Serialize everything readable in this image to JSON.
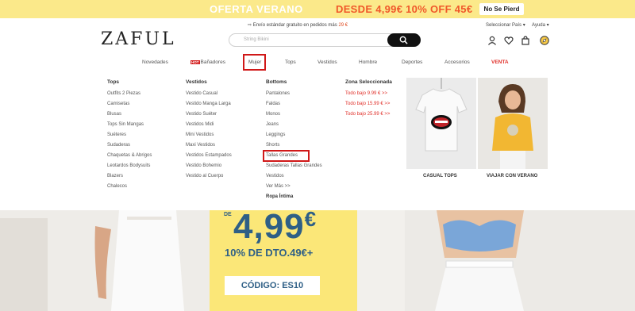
{
  "promo": {
    "left_text": "OFERTA VERANO",
    "right_text": "DESDE 4,99€ 10% OFF 45€",
    "button": "No Se Pierd"
  },
  "info": {
    "shipping_prefix": "Envío estándar gratuito en pedidos más",
    "shipping_amount": "29 €",
    "country": "Seleccionar País ▾",
    "help": "Ayuda ▾"
  },
  "header": {
    "logo": "ZAFUL",
    "search_placeholder": "String Bikini"
  },
  "nav": {
    "items": [
      "Novedades",
      "Bañadores",
      "Mujer",
      "Tops",
      "Vestidos",
      "Hombre",
      "Deportes",
      "Accesorios",
      "VENTA"
    ],
    "hot_badge": "HOT"
  },
  "menu": {
    "tops": {
      "title": "Tops",
      "items": [
        "Outfits 2 Piezas",
        "Camisetas",
        "Blusas",
        "Tops Sin Mangas",
        "Suéteres",
        "Sudaderas",
        "Chaquetas & Abrigos",
        "Leotardos Bodysuits",
        "Blazers",
        "Chalecos"
      ]
    },
    "vestidos": {
      "title": "Vestidos",
      "items": [
        "Vestido Casual",
        "Vestido Manga Larga",
        "Vestido Suéter",
        "Vestidos Midi",
        "Mini Vestidos",
        "Maxi Vestidos",
        "Vestidos Estampados",
        "Vestido Bohemio",
        "Vestido al Cuerpo"
      ]
    },
    "bottoms": {
      "title": "Bottoms",
      "items": [
        "Pantalones",
        "Faldas",
        "Monos",
        "Jeans",
        "Leggings",
        "Shorts",
        "Tallas Grandes",
        "Sudaderas Tallas Grandes",
        "Vestidos",
        "Ver Más >>"
      ],
      "extra": "Ropa Íntima"
    },
    "zona": {
      "title": "Zona Seleccionada",
      "items": [
        "Todo bajo 9.99 € >>",
        "Todo bajo 15.99 € >>",
        "Todo bajo 25.99 € >>"
      ]
    },
    "promo_tiles": [
      "CASUAL TOPS",
      "VIAJAR CON VERANO"
    ]
  },
  "hero": {
    "de": "DE",
    "price": "4,99",
    "currency": "€",
    "discount": "10% DE DTO.49€+",
    "code": "CÓDIGO: ES10"
  },
  "colors": {
    "promo_bg": "#fbe98a",
    "accent_red": "#e0302a",
    "hero_blue": "#2e5f86",
    "hero_yellow": "#fbe778"
  }
}
